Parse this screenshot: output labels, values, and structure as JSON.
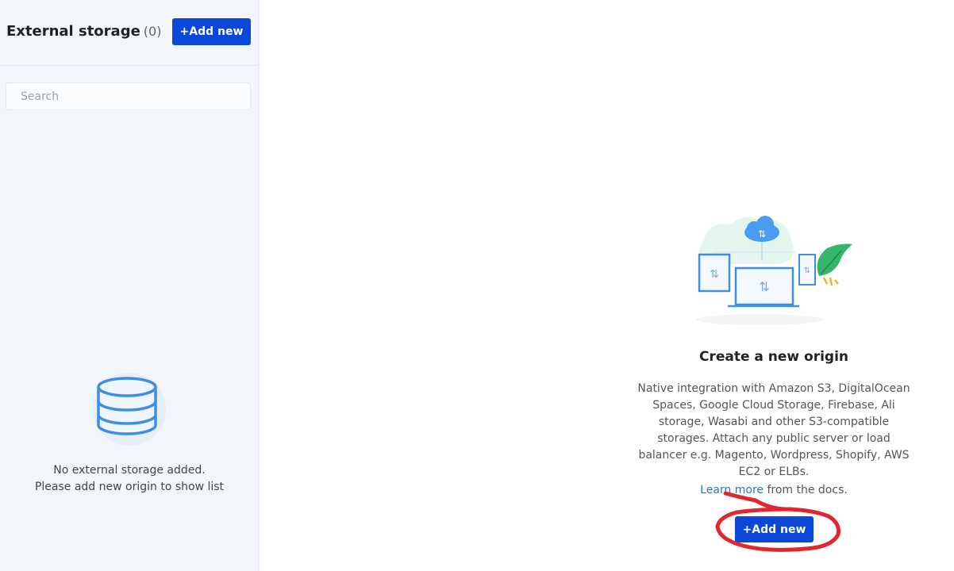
{
  "sidebar": {
    "title": "External storage",
    "count": "(0)",
    "add_label": "+Add new",
    "search_placeholder": "Search",
    "empty_line1": "No external storage added.",
    "empty_line2": "Please add new origin to show list"
  },
  "main": {
    "title": "Create a new origin",
    "description": "Native integration with Amazon S3, DigitalOcean Spaces, Google Cloud Storage, Firebase, Ali storage, Wasabi and other S3-compatible storages. Attach any public server or load balancer e.g. Magento, Wordpress, Shopify, AWS EC2 or ELBs.",
    "learn_link": "Learn more",
    "learn_suffix": " from the docs.",
    "add_label": "+Add new"
  },
  "icons": {
    "database": "database-icon",
    "cloud_devices": "cloud-devices-illustration"
  },
  "colors": {
    "primary": "#0b47d8",
    "link": "#2a72d6",
    "annotation": "#e0262e"
  }
}
